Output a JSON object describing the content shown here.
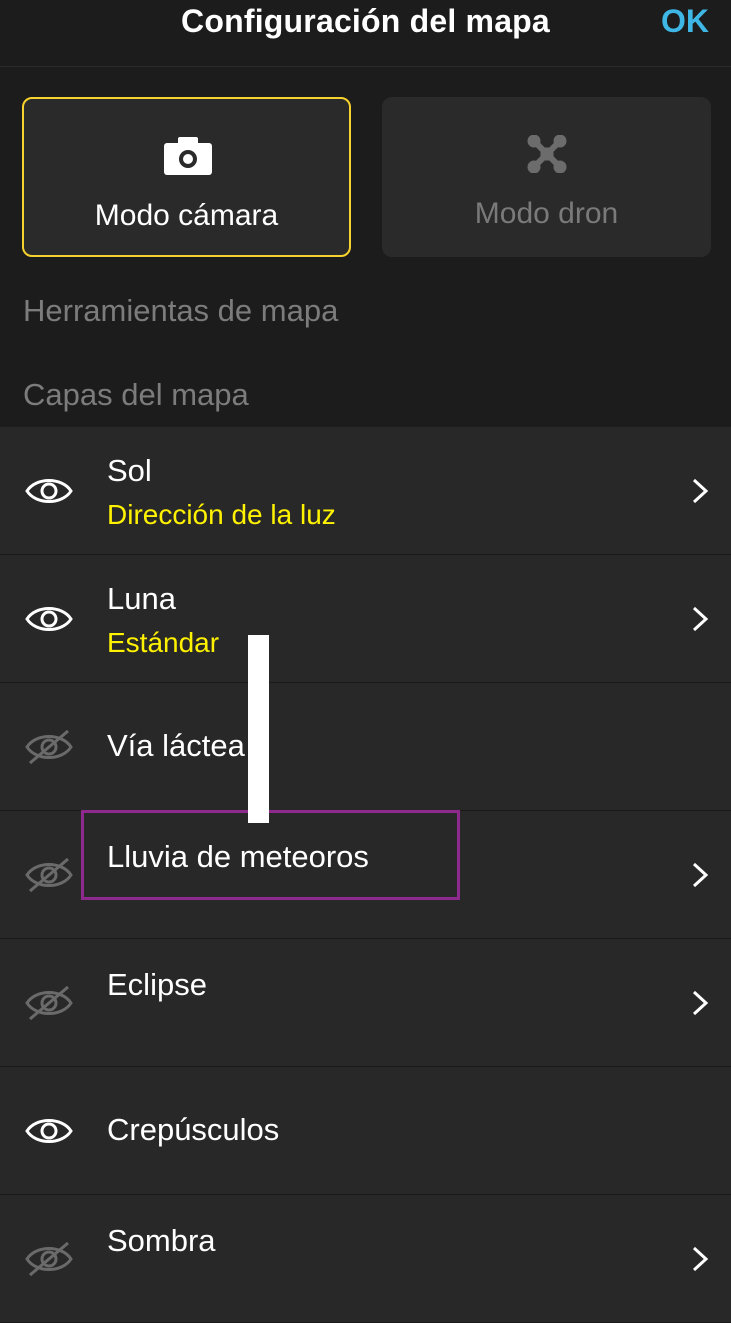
{
  "header": {
    "title": "Configuración del mapa",
    "ok_label": "OK",
    "ok_color": "#3fb7e6"
  },
  "modes": [
    {
      "label": "Modo cámara",
      "icon": "camera-icon",
      "selected": true
    },
    {
      "label": "Modo dron",
      "icon": "drone-icon",
      "selected": false
    }
  ],
  "sections": {
    "tools_label": "Herramientas de mapa",
    "layers_label": "Capas del mapa"
  },
  "layers": [
    {
      "title": "Sol",
      "subtitle": "Dirección de la luz",
      "visible": true,
      "has_chevron": true
    },
    {
      "title": "Luna",
      "subtitle": "Estándar",
      "visible": true,
      "has_chevron": true
    },
    {
      "title": "Vía láctea",
      "subtitle": "",
      "visible": false,
      "has_chevron": false
    },
    {
      "title": "Lluvia de meteoros",
      "subtitle": "",
      "visible": false,
      "has_chevron": true
    },
    {
      "title": "Eclipse",
      "subtitle": "",
      "visible": false,
      "has_chevron": true
    },
    {
      "title": "Crepúsculos",
      "subtitle": "",
      "visible": true,
      "has_chevron": false
    },
    {
      "title": "Sombra",
      "subtitle": "",
      "visible": false,
      "has_chevron": true
    }
  ],
  "colors": {
    "accent_yellow": "#f5d22e",
    "subtitle_yellow": "#fff200",
    "highlight_purple": "#8e2a8e"
  }
}
